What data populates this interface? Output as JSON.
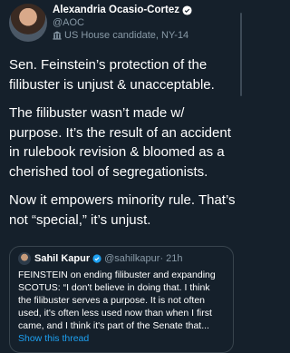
{
  "author": {
    "name": "Alexandria Ocasio-Cortez",
    "handle": "@AOC",
    "label": "US House candidate, NY-14"
  },
  "tweet": {
    "paragraphs": [
      "Sen. Feinstein’s protection of the filibuster is unjust & unacceptable.",
      "The filibuster wasn’t made w/ purpose. It’s the result of an accident in rulebook revision & bloomed as a cherished tool of segregationists.",
      "Now it empowers minority rule. That’s not “special,” it’s unjust."
    ]
  },
  "quoted": {
    "name": "Sahil Kapur",
    "handle": "@sahilkapur",
    "time": "· 21h",
    "text": "FEINSTEIN on ending filibuster and expanding SCOTUS: “I don't believe in doing that. I think the filibuster serves a purpose. It is not often used, it's often less used now than when I first came, and I think it's part of the Senate that...",
    "show_thread": "Show this thread"
  },
  "colors": {
    "background": "#15202b",
    "secondary": "#8899a6",
    "link": "#1da1f2",
    "border": "#38444d"
  },
  "icons": [
    "verified-badge-icon",
    "government-building-icon"
  ]
}
